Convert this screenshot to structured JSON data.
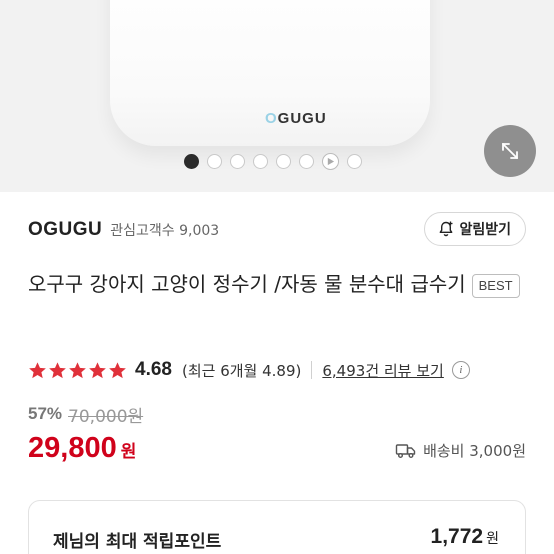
{
  "hero": {
    "device_logo": "GUGU",
    "device_logo_prefix": "O",
    "carousel_dots": 8,
    "active_index": 0,
    "video_index": 6
  },
  "brand": {
    "name": "OGUGU",
    "followers": "관심고객수 9,003",
    "alarm_button": "알림받기"
  },
  "product": {
    "title": "오구구 강아지 고양이 정수기 /자동 물 분수대 급수기",
    "badge": "BEST"
  },
  "rating": {
    "value": "4.68",
    "stars": 5,
    "recent": "(최근 6개월 4.89)",
    "review_link": "6,493건 리뷰 보기",
    "info_icon": "i"
  },
  "price": {
    "discount_rate": "57%",
    "original": "70,000원",
    "sale": "29,800",
    "currency": "원"
  },
  "shipping": {
    "text": "배송비 3,000원"
  },
  "points": {
    "label": "제님의 최대 적립포인트",
    "value": "1,772",
    "unit": "원"
  },
  "colors": {
    "accent_red": "#d0021b",
    "star_red": "#e0313a"
  }
}
